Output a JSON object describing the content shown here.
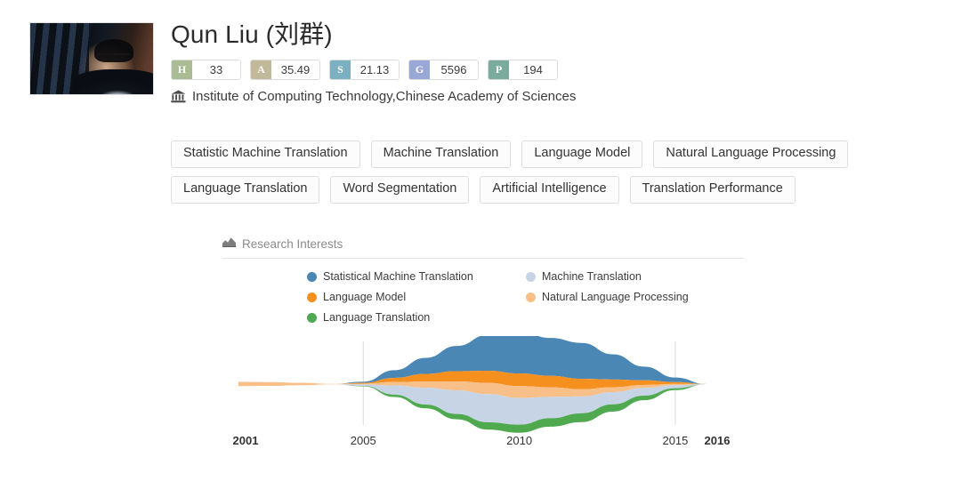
{
  "profile": {
    "name": "Qun Liu (刘群)",
    "avatar_alt": "portrait-photo",
    "affiliation": "Institute of Computing Technology,Chinese Academy of Sciences",
    "affiliation_icon": "bank-icon",
    "metrics": [
      {
        "key": "H",
        "value": "33",
        "color": "#a9bc94"
      },
      {
        "key": "A",
        "value": "35.49",
        "color": "#c2b89a"
      },
      {
        "key": "S",
        "value": "21.13",
        "color": "#7bb0c0"
      },
      {
        "key": "G",
        "value": "5596",
        "color": "#9aa8d8"
      },
      {
        "key": "P",
        "value": "194",
        "color": "#7aab9c"
      }
    ]
  },
  "tags": [
    "Statistic Machine Translation",
    "Machine Translation",
    "Language Model",
    "Natural Language Processing",
    "Language Translation",
    "Word Segmentation",
    "Artificial Intelligence",
    "Translation Performance"
  ],
  "section": {
    "title": "Research Interests",
    "icon": "area-chart-icon"
  },
  "chart_data": {
    "type": "area",
    "title": "Research Interests",
    "xlabel": "",
    "ylabel": "",
    "grid": true,
    "gridlines_at": [
      2005,
      2010,
      2015
    ],
    "legend_position": "top",
    "xlim": [
      2001,
      2016
    ],
    "tick_labels": [
      "2001",
      "2005",
      "2010",
      "2015",
      "2016"
    ],
    "bold_ticks": [
      "2001",
      "2016"
    ],
    "x": [
      2001,
      2002,
      2003,
      2004,
      2005,
      2006,
      2007,
      2008,
      2009,
      2010,
      2011,
      2012,
      2013,
      2014,
      2015,
      2016
    ],
    "series": [
      {
        "name": "Statistical Machine Translation",
        "color": "#4a87b5",
        "values": [
          0,
          0,
          0,
          0,
          0.3,
          2.0,
          4.2,
          6.6,
          9.4,
          11.0,
          9.9,
          9.4,
          6.6,
          3.6,
          1.2,
          0
        ]
      },
      {
        "name": "Machine Translation",
        "color": "#c7d4e6",
        "values": [
          0,
          0,
          0,
          0,
          0.4,
          2.4,
          4.4,
          6.2,
          7.4,
          7.0,
          5.6,
          4.4,
          3.2,
          2.0,
          0.8,
          0
        ]
      },
      {
        "name": "Language Model",
        "color": "#f5901f",
        "values": [
          0,
          0,
          0,
          0,
          0.2,
          1.1,
          2.0,
          2.7,
          3.2,
          3.3,
          3.0,
          2.7,
          2.0,
          1.2,
          0.5,
          0
        ]
      },
      {
        "name": "Natural Language Processing",
        "color": "#f8c088",
        "values": [
          1.1,
          1.0,
          0.6,
          0.1,
          0.2,
          0.9,
          1.6,
          2.3,
          2.9,
          3.1,
          2.5,
          1.9,
          1.3,
          0.8,
          0.3,
          0
        ]
      },
      {
        "name": "Language Translation",
        "color": "#4fa94f",
        "values": [
          0,
          0,
          0,
          0,
          0.1,
          0.6,
          1.0,
          1.4,
          1.9,
          2.1,
          2.2,
          2.3,
          1.9,
          1.2,
          0.5,
          0
        ]
      }
    ]
  }
}
